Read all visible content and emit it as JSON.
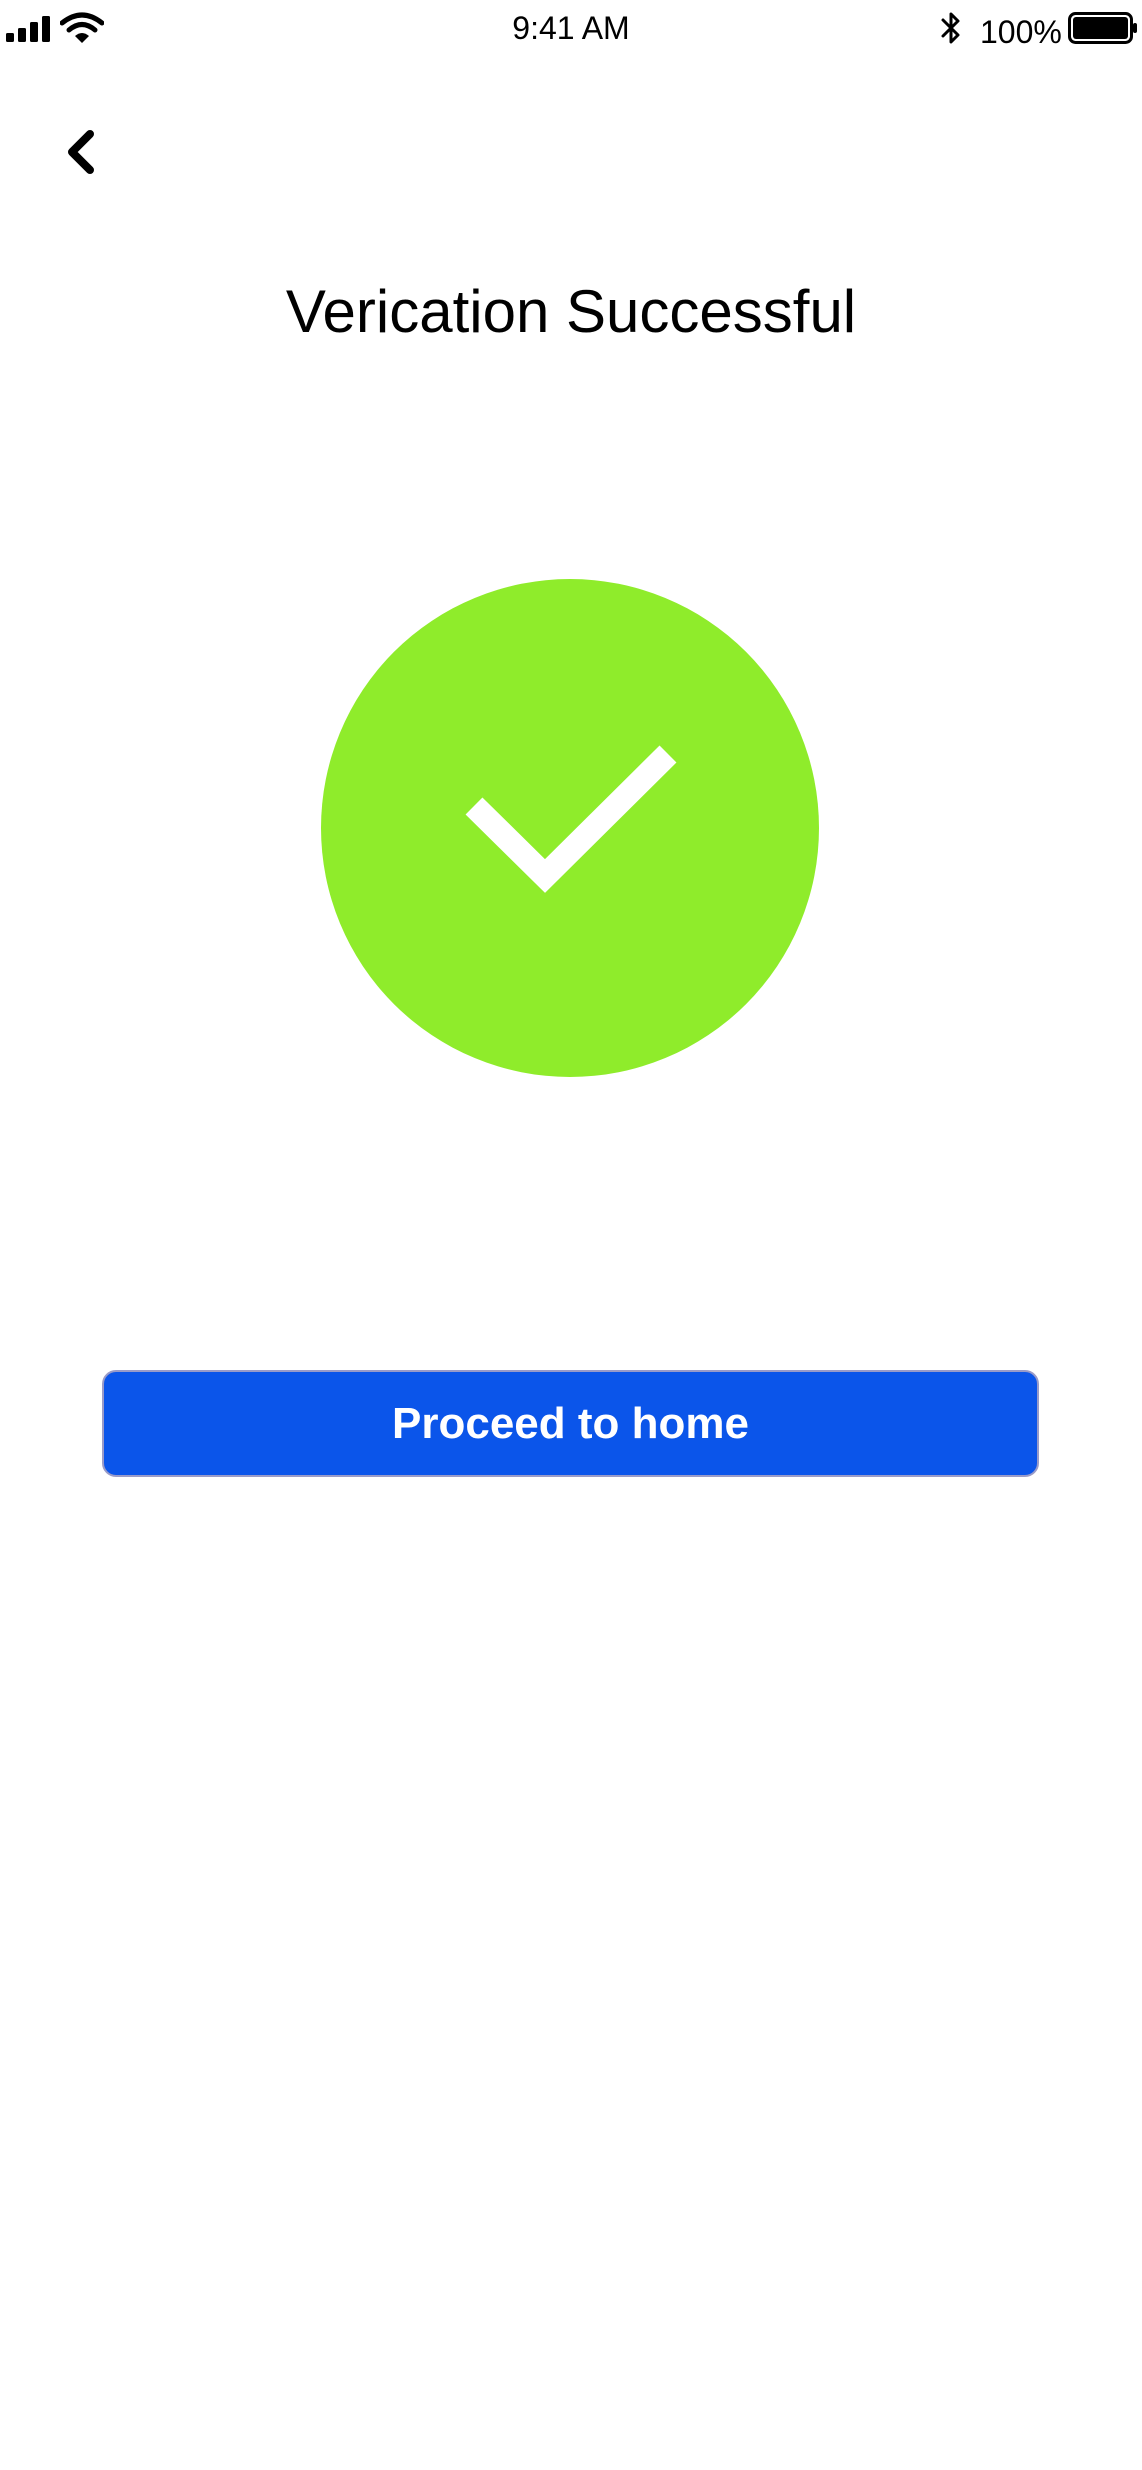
{
  "status_bar": {
    "time": "9:41 AM",
    "battery_percent": "100%",
    "icons": [
      "signal-icon",
      "wifi-icon",
      "bluetooth-icon",
      "battery-icon"
    ]
  },
  "header": {
    "back_icon": "chevron-left-icon",
    "title": "Verication Successful"
  },
  "main": {
    "success_icon": "checkmark-icon",
    "success_color": "#8fec2b",
    "proceed_button": {
      "label": "Proceed to home",
      "color": "#0b55ea"
    }
  }
}
